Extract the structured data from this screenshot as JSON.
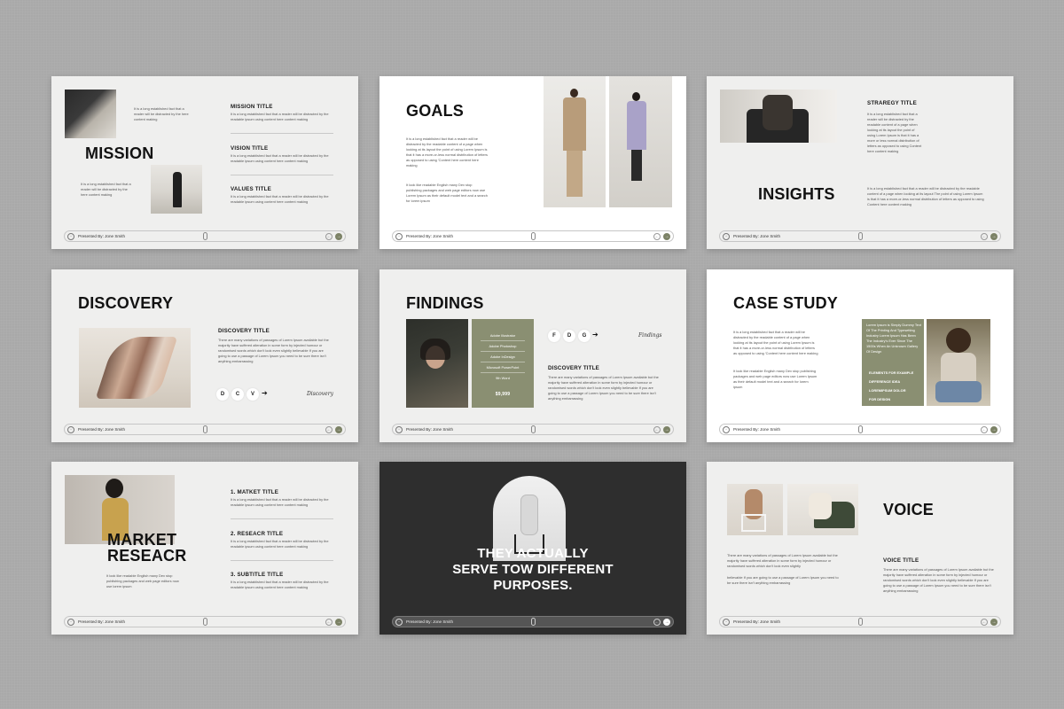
{
  "footer": {
    "presented_by": "Presented By: Jone Smith",
    "user_icon": "user-circle-icon",
    "prev_icon": "arrow-left-icon",
    "next_icon": "arrow-right-icon",
    "prev_glyph": "←",
    "next_glyph": "→",
    "user_glyph": "◦"
  },
  "colors": {
    "accent_green": "#8a8f72",
    "dark_slide": "#2e2e2e",
    "background": "#a9a9a9"
  },
  "slide1": {
    "title": "MISSION",
    "intro_text": "It is a long established fact that a reader will be distracted by the here content making",
    "lower_text": "It is a long established fact that a reader will be distracted by the here content making",
    "items": [
      {
        "title": "MISSION TITLE",
        "text": "It is a long established fact that a reader will be distracted by the readable ipsum using content here content making"
      },
      {
        "title": "VISION TITLE",
        "text": "It is a long established fact that a reader will be distracted by the readable ipsum using content here content making"
      },
      {
        "title": "VALUES TITLE",
        "text": "It is a long established fact that a reader will be distracted by the readable ipsum using content here content making"
      }
    ]
  },
  "slide2": {
    "title": "GOALS",
    "text1": "It is a long established fact that a reader will be distracted by the readable content of a page when looking at its layout the point of using Lorem Ipsum is that it has a more-or-less normal distribution of letters as opposed to using 'Content here content here making",
    "text2": "It look like readable English many Dex stop publishing packages and web page editors now use Lorem Ipsum as their default model text and a search for lorem ipsum"
  },
  "slide3": {
    "title": "INSIGHTS",
    "strategy_title": "STRAREGY TITLE",
    "text1": "It is a long established fact that a reader will be distracted by the readable content of a page when looking at its layout the point of using Lorem Ipsum is that it has a more or less normal distribution of letters as opposed to using Content here content making",
    "text2": "It is a long established fact that a reader will be distracted by the readable content of a page when looking at its layout The point of using Lorem Ipsum is that it has a more-or-less normal distribution of letters as opposed to using Content here content making"
  },
  "slide4": {
    "title": "DISCOVERY",
    "sub_title": "DISCOVERY TITLE",
    "text": "There are many variations of passages of Lorem Ipsum available but the majority have suffered alteration in some form by injected humour or randomised words which don't look even slightly believable If you are going to use a passage of Lorem Ipsum you need to be sure there isn't anything embarrassing",
    "letters": [
      "D",
      "C",
      "V"
    ],
    "arrow": "➔",
    "signature": "Discovery"
  },
  "slide5": {
    "title": "FINDINGS",
    "sub_title": "DISCOVERY TITLE",
    "list": [
      "Adobe Illustrator",
      "Adobe Photoshop",
      "Adobe InDesign",
      "Microsoft PowerPoint",
      "9th Word"
    ],
    "price": "$9,999",
    "letters": [
      "F",
      "D",
      "G"
    ],
    "arrow": "➔",
    "signature": "Findings",
    "text": "There are many variations of passages of Lorem Ipsum available but the majority have suffered alteration in some form by injected humour or randomised words which don't look even slightly believable If you are going to use a passage of Lorem Ipsum you need to be sure there isn't anything embarrassing"
  },
  "slide6": {
    "title": "CASE STUDY",
    "text1": "It is a long established fact that a reader will be distracted by the readable content of a page when looking at its layout the point of using Lorem Ipsum is that it has a more-or-less normal distribution of letters as opposed to using 'Content here content here making",
    "text2": "It look like readable English many Dex stop publishing packages and web page editors now use Lorem Ipsum as their default model text and a search for lorem ipsum",
    "panel_text": "Lorem Ipsum is Simply Dummy Text Of The Printing And Typesetting Industry Lorem Ipsum Has Been The Industry's Ever Since The 1500s When An Unknown Gallery Of Design",
    "panel_items": [
      "ELEMENTS FOR EXAMPLE",
      "DIFFERENCE IDEA",
      "LOREMIPSUM DOLOR",
      "FOR DESIGN"
    ]
  },
  "slide7": {
    "title_line1": "MARKET",
    "title_line2": "RESEACR",
    "text": "It look like readable English many Dex stop publishing packages and web page editors now use lorem ipsum",
    "items": [
      {
        "title": "1. MATKET TITLE",
        "text": "It is a long established fact that a reader will be distracted by the readable ipsum using content here content making"
      },
      {
        "title": "2. RESEACR TITLE",
        "text": "It is a long established fact that a reader will be distracted by the readable ipsum using content here content making"
      },
      {
        "title": "3. SUBTITLE TITLE",
        "text": "It is a long established fact that a reader will be distracted by the readable ipsum using content here content making"
      }
    ]
  },
  "slide8": {
    "line1": "THEY ACTUALLY",
    "line2": "SERVE TOW DIFFERENT",
    "line3": "PURPOSES."
  },
  "slide9": {
    "title": "VOICE",
    "sub_title": "VOICE TITLE",
    "text1": "There are many variations of passages of Lorem Ipsum available but the majority have suffered alteration in some form by injected humour or randomised words which don't look even slightly",
    "text2": "believable If you are going to use a passage of Lorem Ipsum you need to be sure there isn't anything embarrassing",
    "right_text": "There are many variations of passages of Lorem Ipsum available but the majority have suffered alteration in some form by injected humour or randomised words which don't look even slightly believable If you are going to use a passage of Lorem Ipsum you need to be sure there isn't anything embarrassing"
  }
}
